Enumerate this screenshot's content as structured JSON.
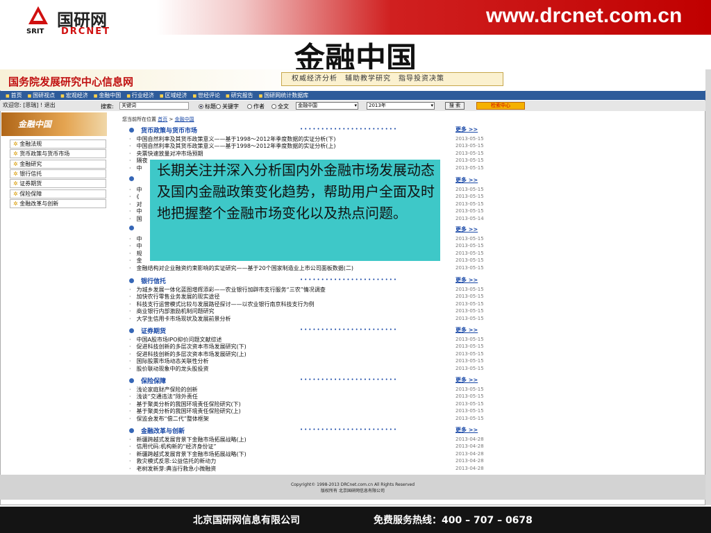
{
  "header": {
    "logo_cn": "国研网",
    "logo_srit": "SRIT",
    "logo_en": "DRCNET",
    "site_url": "www.drcnet.com.cn"
  },
  "slide_title": "金融中国",
  "site": {
    "name": "国务院发展研究中心信息网",
    "ad_text": "权威经济分析　辅助教学研究　指导投资决策",
    "nav": [
      "首页",
      "国研视点",
      "宏观经济",
      "金融中国",
      "行业经济",
      "区域经济",
      "世经评论",
      "研究报告",
      "国研网统计数据库"
    ],
    "welcome": "欢迎您: [恩瑞] ! 退出",
    "search_label": "搜索:",
    "search_value": "关键词",
    "radios": [
      "标题",
      "关键字",
      "作者",
      "全文"
    ],
    "channel_select": "金融中国",
    "year_select": "2013年",
    "search_button": "搜 索",
    "search_center": "检索中心"
  },
  "sidebar": {
    "banner": "金融中国",
    "items": [
      "金融法规",
      "货币政策与货币市场",
      "金融研究",
      "银行信托",
      "证券期货",
      "保险保障",
      "金融改革与创新"
    ]
  },
  "breadcrumb": {
    "prefix": "您当前所在位置",
    "home": "首页",
    "sep": ">",
    "current": "金融中国"
  },
  "more_label": "更多 >>",
  "sections": [
    {
      "title": "货币政策与货币市场",
      "rows": [
        {
          "text": "中国自然利率及其货币政策意义——基于1998～2012年季度数据的实证分析(下)",
          "date": "2013-05-15"
        },
        {
          "text": "中国自然利率及其货币政策意义——基于1998～2012年季度数据的实证分析(上)",
          "date": "2013-05-15"
        },
        {
          "text": "央票快速放量对冲市场预期",
          "date": "2013-05-15"
        },
        {
          "text": "隔夜",
          "date": "2013-05-15"
        },
        {
          "text": "中",
          "date": "2013-05-15"
        }
      ]
    },
    {
      "title": "",
      "rows": [
        {
          "text": "中",
          "date": "2013-05-15"
        },
        {
          "text": "《",
          "date": "2013-05-15"
        },
        {
          "text": "对",
          "date": "2013-05-15"
        },
        {
          "text": "中",
          "date": "2013-05-15"
        },
        {
          "text": "国",
          "date": "2013-05-14"
        }
      ]
    },
    {
      "title": "",
      "rows": [
        {
          "text": "中",
          "date": "2013-05-15"
        },
        {
          "text": "中",
          "date": "2013-05-15"
        },
        {
          "text": "规",
          "date": "2013-05-15"
        },
        {
          "text": "金",
          "date": "2013-05-15"
        },
        {
          "text": "金融结构对企业融资约束影响的实证研究——基于20个国家制造业上市公司面板数据(二)",
          "date": "2013-05-15"
        }
      ]
    },
    {
      "title": "银行信托",
      "rows": [
        {
          "text": "为城乡发展一体化蓝图增辉添彩——农业银行加辟市支行服务“三农”情况调查",
          "date": "2013-05-15"
        },
        {
          "text": "加快农行零售业务发展的现实途径",
          "date": "2013-05-15"
        },
        {
          "text": "科技支行运营模式比较与发展路径探讨——以农业银行南京科技支行为例",
          "date": "2013-05-15"
        },
        {
          "text": "商业银行内部激励机制问题研究",
          "date": "2013-05-15"
        },
        {
          "text": "大学生信用卡市场现状及发展前景分析",
          "date": "2013-05-15"
        }
      ]
    },
    {
      "title": "证券期货",
      "rows": [
        {
          "text": "中国A股市场IPO抑价问题文献综述",
          "date": "2013-05-15"
        },
        {
          "text": "促进科技创新的多层次资本市场发展研究(下)",
          "date": "2013-05-15"
        },
        {
          "text": "促进科技创新的多层次资本市场发展研究(上)",
          "date": "2013-05-15"
        },
        {
          "text": "国际股票市场动态关联性分析",
          "date": "2013-05-15"
        },
        {
          "text": "股价联动现象中的龙头股投资",
          "date": "2013-05-15"
        }
      ]
    },
    {
      "title": "保险保障",
      "rows": [
        {
          "text": "浅论家庭财产保险的创新",
          "date": "2013-05-15"
        },
        {
          "text": "浅谈“交通违法”除外责任",
          "date": "2013-05-15"
        },
        {
          "text": "基于聚类分析的我国环境责任保险研究(下)",
          "date": "2013-05-15"
        },
        {
          "text": "基于聚类分析的我国环境责任保险研究(上)",
          "date": "2013-05-15"
        },
        {
          "text": "保监会发布“偿二代”整体框架",
          "date": "2013-05-15"
        }
      ]
    },
    {
      "title": "金融改革与创新",
      "rows": [
        {
          "text": "新疆跨越式发展背景下金融市场拓展战略(上)",
          "date": "2013-04-28"
        },
        {
          "text": "信用代码:机构新的“经济身份证”",
          "date": "2013-04-28"
        },
        {
          "text": "新疆跨越式发展背景下金融市场拓展战略(下)",
          "date": "2013-04-28"
        },
        {
          "text": "救灾模式反思:公益信托的新动力",
          "date": "2013-04-28"
        },
        {
          "text": "老树发新芽:典当行救急小微融资",
          "date": "2013-04-28"
        }
      ]
    }
  ],
  "overlay_text": "长期关注并深入分析国内外金融市场发展动态及国内金融政策变化趋势，帮助用户全面及时地把握整个金融市场变化以及热点问题。",
  "site_footer": {
    "line1": "Copyright© 1998-2013 DRCnet.com.cn All Rights Reserved",
    "line2": "版权所有 北京国研网信息有限公司"
  },
  "bottom": {
    "company": "北京国研网信息有限公司",
    "hotline": "免费服务热线：400 – 707 – 0678"
  },
  "colors": {
    "brand_red": "#c00000",
    "link_blue": "#1747a6",
    "overlay": "#3ec8c8"
  }
}
